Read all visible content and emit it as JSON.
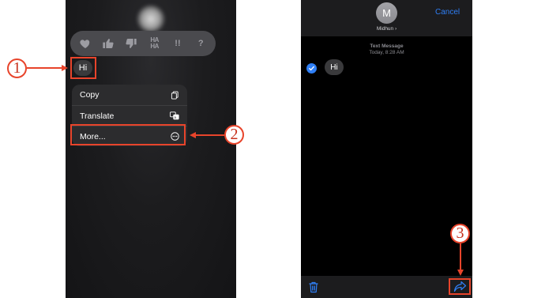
{
  "left_screen": {
    "reactions": [
      "heart",
      "thumbs-up",
      "thumbs-down",
      "HA HA",
      "!!",
      "?"
    ],
    "message_text": "Hi",
    "menu": [
      {
        "label": "Copy",
        "icon": "copy-icon"
      },
      {
        "label": "Translate",
        "icon": "translate-icon"
      },
      {
        "label": "More...",
        "icon": "more-ellipsis-icon"
      }
    ]
  },
  "right_screen": {
    "avatar_letter": "M",
    "contact_name": "Midhun ›",
    "cancel_label": "Cancel",
    "meta_line1": "Text Message",
    "meta_line2": "Today, 8:28 AM",
    "message_text": "Hi"
  },
  "callouts": {
    "one": "1",
    "two": "2",
    "three": "3"
  },
  "colors": {
    "annotation": "#e8442b",
    "ios_blue": "#2f7ff6"
  }
}
